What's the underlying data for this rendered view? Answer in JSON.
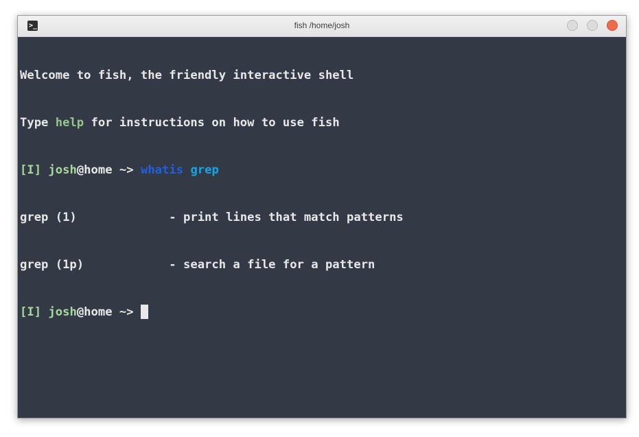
{
  "window": {
    "title": "fish /home/josh",
    "app_icon_glyph": ">_"
  },
  "terminal": {
    "welcome_line": "Welcome to fish, the friendly interactive shell",
    "help_line_prefix": "Type ",
    "help_word": "help",
    "help_line_suffix": " for instructions on how to use fish",
    "prompt": {
      "mode": "[I]",
      "user": "josh",
      "at": "@",
      "host": "home",
      "dir": " ~> "
    },
    "command": {
      "name": "whatis",
      "arg": "grep"
    },
    "output": [
      {
        "text": "grep (1)             - print lines that match patterns"
      },
      {
        "text": "grep (1p)            - search a file for a pattern"
      }
    ]
  },
  "colors": {
    "terminal_bg": "#343a45",
    "command_color": "#1f5fe0",
    "argument_color": "#12a7e6",
    "help_color": "#96c58e",
    "close_button": "#ec6a4d"
  }
}
